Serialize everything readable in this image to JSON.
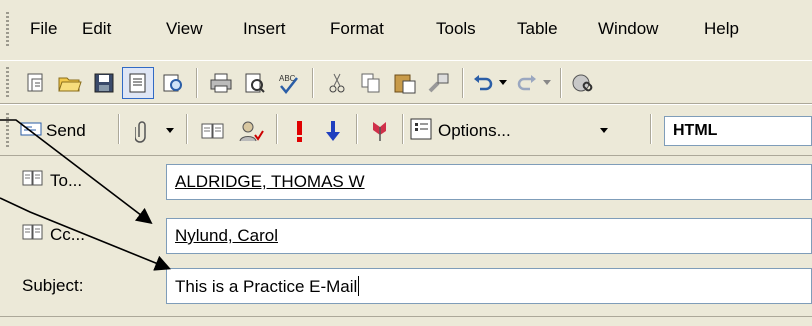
{
  "menu": {
    "items": [
      {
        "label": "File"
      },
      {
        "label": "Edit"
      },
      {
        "label": "View"
      },
      {
        "label": "Insert"
      },
      {
        "label": "Format"
      },
      {
        "label": "Tools"
      },
      {
        "label": "Table"
      },
      {
        "label": "Window"
      },
      {
        "label": "Help"
      }
    ]
  },
  "toolbar2": {
    "send_label": "Send",
    "options_label": "Options...",
    "format_value": "HTML"
  },
  "form": {
    "to_label": "To...",
    "cc_label": "Cc...",
    "subject_label": "Subject:",
    "to_value": "ALDRIDGE, THOMAS W",
    "cc_value": "Nylund, Carol",
    "subject_value": "This is a Practice E-Mail"
  },
  "colors": {
    "chrome": "#ece9d8",
    "field_border": "#7f9db9",
    "importance_high": "#e00000",
    "importance_low": "#1f3fbf"
  }
}
